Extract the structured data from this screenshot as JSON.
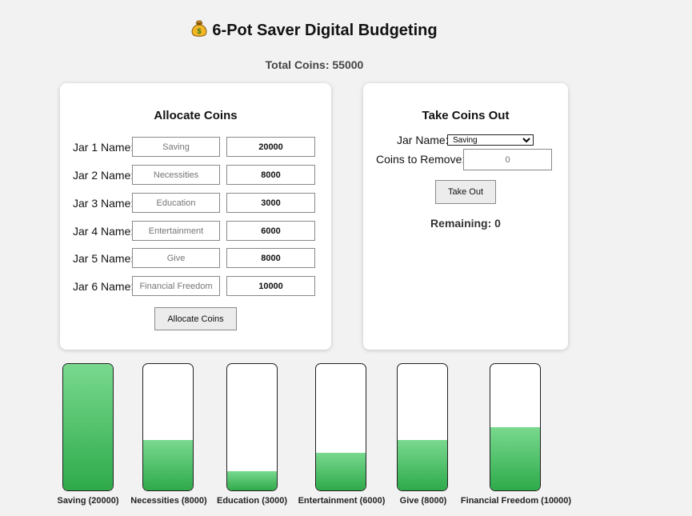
{
  "header": {
    "title": "6-Pot Saver Digital Budgeting",
    "icon": "money-bag-icon",
    "total_label": "Total Coins: 55000"
  },
  "allocate": {
    "heading": "Allocate Coins",
    "rows": [
      {
        "label": "Jar 1 Name:",
        "name_placeholder": "Saving",
        "amount": "20000"
      },
      {
        "label": "Jar 2 Name:",
        "name_placeholder": "Necessities",
        "amount": "8000"
      },
      {
        "label": "Jar 3 Name:",
        "name_placeholder": "Education",
        "amount": "3000"
      },
      {
        "label": "Jar 4 Name:",
        "name_placeholder": "Entertainment",
        "amount": "6000"
      },
      {
        "label": "Jar 5 Name:",
        "name_placeholder": "Give",
        "amount": "8000"
      },
      {
        "label": "Jar 6 Name:",
        "name_placeholder": "Financial Freedom",
        "amount": "10000"
      }
    ],
    "button_label": "Allocate Coins"
  },
  "take_out": {
    "heading": "Take Coins Out",
    "jar_label": "Jar Name:",
    "selected_jar": "Saving",
    "coins_label": "Coins to Remove:",
    "coins_placeholder": "0",
    "button_label": "Take Out",
    "remaining": "Remaining: 0"
  },
  "jars": [
    {
      "label": "Saving (20000)",
      "fill_percent": 100
    },
    {
      "label": "Necessities (8000)",
      "fill_percent": 40
    },
    {
      "label": "Education (3000)",
      "fill_percent": 15
    },
    {
      "label": "Entertainment (6000)",
      "fill_percent": 30
    },
    {
      "label": "Give (8000)",
      "fill_percent": 40
    },
    {
      "label": "Financial Freedom (10000)",
      "fill_percent": 50
    }
  ],
  "colors": {
    "fill_top": "#79d98f",
    "fill_bottom": "#2eaa4a",
    "background": "#f2f2f2"
  }
}
